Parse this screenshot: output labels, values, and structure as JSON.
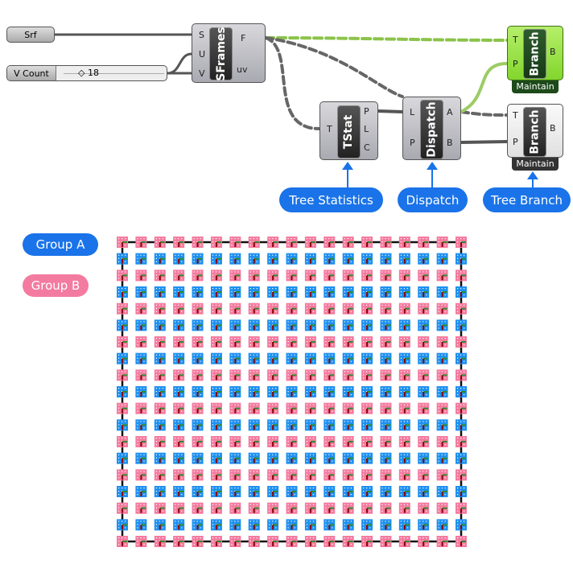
{
  "params": {
    "srf": "Srf",
    "slider_label": "V Count",
    "slider_value": "18"
  },
  "sframes": {
    "name": "SFrames",
    "inputs": [
      "S",
      "U",
      "V"
    ],
    "outputs": [
      "F",
      "uv"
    ]
  },
  "tstat": {
    "name": "TStat",
    "inputs": [
      "T"
    ],
    "outputs": [
      "P",
      "L",
      "C"
    ]
  },
  "dispatch": {
    "name": "Dispatch",
    "inputs": [
      "L",
      "P"
    ],
    "outputs": [
      "A",
      "B"
    ]
  },
  "branch_a": {
    "name": "Branch",
    "inputs": [
      "T",
      "P"
    ],
    "outputs": [
      "B"
    ],
    "footer": "Maintain"
  },
  "branch_b": {
    "name": "Branch",
    "inputs": [
      "T",
      "P"
    ],
    "outputs": [
      "B"
    ],
    "footer": "Maintain"
  },
  "callouts": {
    "tstat": "Tree Statistics",
    "dispatch": "Dispatch",
    "branch": "Tree Branch"
  },
  "legend": {
    "group_a": "Group A",
    "group_b": "Group B",
    "color_a": "#1e90f0",
    "color_b": "#f47ba0"
  },
  "grid": {
    "columns": 19,
    "rows": 19,
    "pattern": "rows alternate Group B / Group A starting with Group B"
  }
}
